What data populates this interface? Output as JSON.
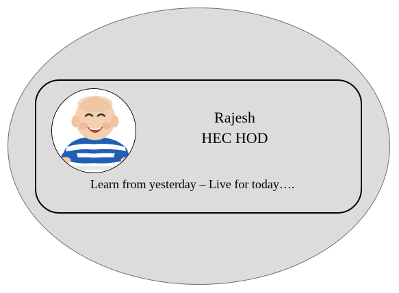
{
  "profile": {
    "name": "Rajesh",
    "title": "HEC HOD",
    "quote": "Learn from yesterday – Live for today….",
    "avatar_icon": "baby-photo-icon"
  },
  "colors": {
    "oval_fill": "#dcdcdc",
    "card_border": "#000000",
    "text": "#000000"
  }
}
